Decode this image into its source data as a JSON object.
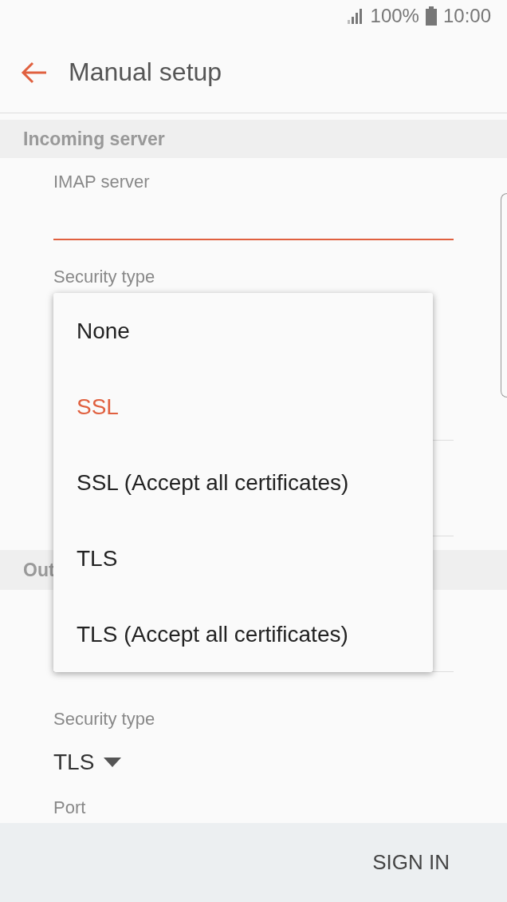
{
  "status_bar": {
    "battery": "100%",
    "time": "10:00"
  },
  "header": {
    "title": "Manual setup"
  },
  "incoming_server": {
    "title": "Incoming server",
    "imap_server": {
      "label": "IMAP server",
      "focused": true
    },
    "security_type": {
      "label": "Security type"
    }
  },
  "security_menu": {
    "options": [
      {
        "label": "None",
        "selected": false
      },
      {
        "label": "SSL",
        "selected": true
      },
      {
        "label": "SSL (Accept all certificates)",
        "selected": false
      },
      {
        "label": "TLS",
        "selected": false
      },
      {
        "label": "TLS (Accept all certificates)",
        "selected": false
      }
    ]
  },
  "outgoing_server": {
    "title": "Out",
    "security_type": {
      "label": "Security type",
      "value": "TLS"
    },
    "port": {
      "label": "Port"
    }
  },
  "sign_in_button": "SIGN IN"
}
